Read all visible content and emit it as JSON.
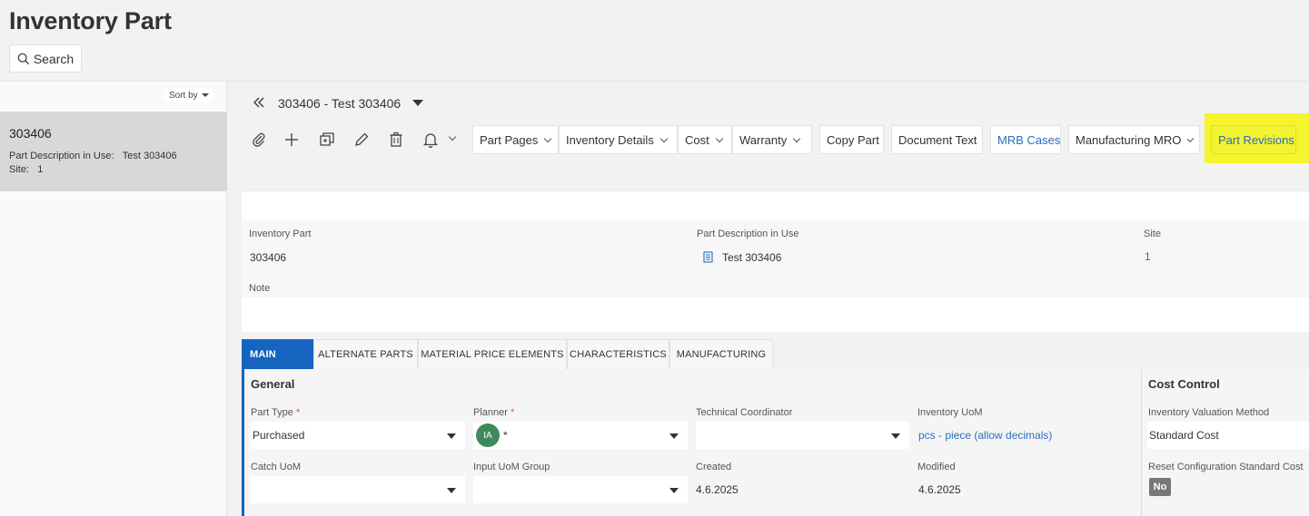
{
  "page": {
    "title": "Inventory Part",
    "search_label": "Search",
    "sort_label": "Sort by"
  },
  "list": {
    "items": [
      {
        "id": "303406",
        "desc_label": "Part Description in Use:",
        "desc_value": "Test 303406",
        "site_label": "Site:",
        "site_value": "1"
      }
    ]
  },
  "record": {
    "title": "303406 - Test 303406"
  },
  "toolbar": {
    "icons": [
      "paperclip-icon",
      "plus-icon",
      "duplicate-icon",
      "pencil-icon",
      "trash-icon",
      "bell-icon"
    ],
    "commands": [
      {
        "label": "Part Pages"
      },
      {
        "label": "Inventory Details"
      },
      {
        "label": "Cost"
      },
      {
        "label": "Warranty"
      },
      {
        "label": "Copy Part"
      },
      {
        "label": "Document Text"
      },
      {
        "label": "MRB Cases"
      },
      {
        "label": "Manufacturing MRO"
      },
      {
        "label": "Part Revisions"
      }
    ],
    "highlight_color": "#f6f42c"
  },
  "header_card": {
    "inventory_part_label": "Inventory Part",
    "inventory_part_value": "303406",
    "part_desc_label": "Part Description in Use",
    "part_desc_value": "Test 303406",
    "site_label": "Site",
    "site_value": "1",
    "note_label": "Note"
  },
  "tabs": [
    {
      "label": "MAIN"
    },
    {
      "label": "ALTERNATE PARTS"
    },
    {
      "label": "MATERIAL PRICE ELEMENTS"
    },
    {
      "label": "CHARACTERISTICS"
    },
    {
      "label": "MANUFACTURING"
    }
  ],
  "general": {
    "title": "General",
    "part_type_label": "Part Type",
    "part_type_value": "Purchased",
    "planner_label": "Planner",
    "planner_initials": "IA",
    "planner_value": "*",
    "tech_coord_label": "Technical Coordinator",
    "uom_label": "Inventory UoM",
    "uom_value": "pcs - piece (allow decimals)",
    "catch_uom_label": "Catch UoM",
    "input_uom_label": "Input UoM Group",
    "created_label": "Created",
    "created_value": "4.6.2025",
    "modified_label": "Modified",
    "modified_value": "4.6.2025",
    "required_mark": "*"
  },
  "cost_control": {
    "title": "Cost Control",
    "valuation_label": "Inventory Valuation Method",
    "valuation_value": "Standard Cost",
    "reset_label": "Reset Configuration Standard Cost",
    "reset_value": "No"
  }
}
